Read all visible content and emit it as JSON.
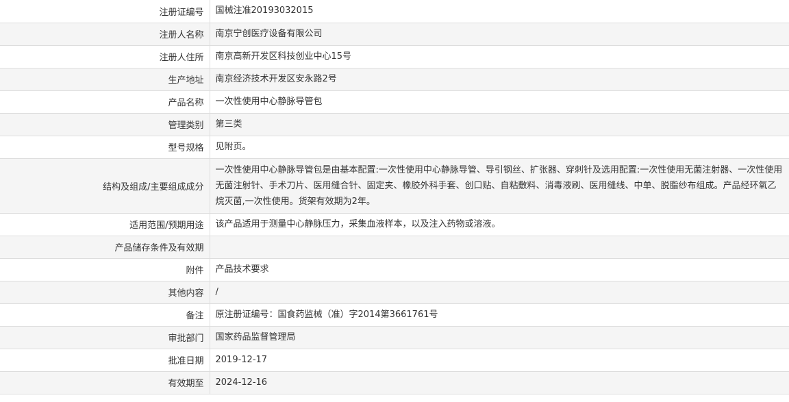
{
  "rows": [
    {
      "label": "注册证编号",
      "value": "国械注准20193032015"
    },
    {
      "label": "注册人名称",
      "value": "南京宁创医疗设备有限公司"
    },
    {
      "label": "注册人住所",
      "value": "南京高新开发区科技创业中心15号"
    },
    {
      "label": "生产地址",
      "value": "南京经济技术开发区安永路2号"
    },
    {
      "label": "产品名称",
      "value": "一次性使用中心静脉导管包"
    },
    {
      "label": "管理类别",
      "value": "第三类"
    },
    {
      "label": "型号规格",
      "value": "见附页。"
    },
    {
      "label": "结构及组成/主要组成成分",
      "value": "一次性使用中心静脉导管包是由基本配置:一次性使用中心静脉导管、导引钢丝、扩张器、穿刺针及选用配置:一次性使用无菌注射器、一次性使用无菌注射针、手术刀片、医用缝合针、固定夹、橡胶外科手套、创口贴、自粘敷料、消毒液刷、医用缝线、中单、脱脂纱布组成。产品经环氧乙烷灭菌,一次性使用。货架有效期为2年。"
    },
    {
      "label": "适用范围/预期用途",
      "value": "该产品适用于测量中心静脉压力，采集血液样本，以及注入药物或溶液。"
    },
    {
      "label": "产品储存条件及有效期",
      "value": ""
    },
    {
      "label": "附件",
      "value": "产品技术要求"
    },
    {
      "label": "其他内容",
      "value": "/"
    },
    {
      "label": "备注",
      "value": "原注册证编号：国食药监械（准）字2014第3661761号"
    },
    {
      "label": "审批部门",
      "value": "国家药品监督管理局"
    },
    {
      "label": "批准日期",
      "value": "2019-12-17"
    },
    {
      "label": "有效期至",
      "value": "2024-12-16"
    }
  ]
}
